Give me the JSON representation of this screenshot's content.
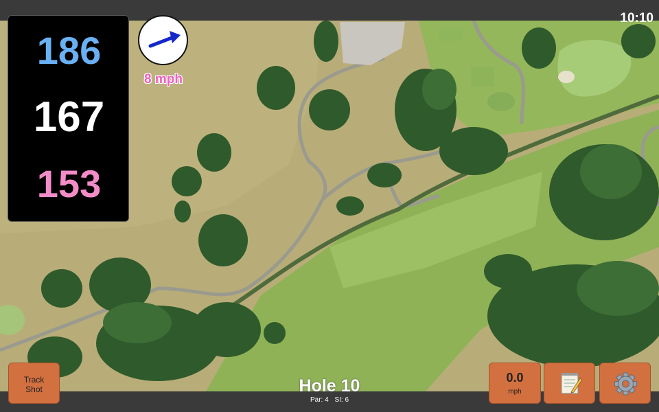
{
  "status": {
    "clock": "10:10"
  },
  "yardages": {
    "back": "186",
    "center": "167",
    "front": "153"
  },
  "wind": {
    "speed_label": "8 mph",
    "icon": "wind-arrow-icon"
  },
  "hole": {
    "title": "Hole 10",
    "par_label": "Par: 4",
    "si_label": "SI: 6"
  },
  "buttons": {
    "track_shot": {
      "line1": "Track",
      "line2": "Shot"
    },
    "speed": {
      "value": "0.0",
      "unit": "mph"
    },
    "notes_icon": "notepad-icon",
    "settings_icon": "gear-icon"
  },
  "colors": {
    "back": "#6ab0f5",
    "center": "#ffffff",
    "front": "#f48cc8",
    "button": "#d2703f",
    "wind_text": "#f060c0"
  }
}
